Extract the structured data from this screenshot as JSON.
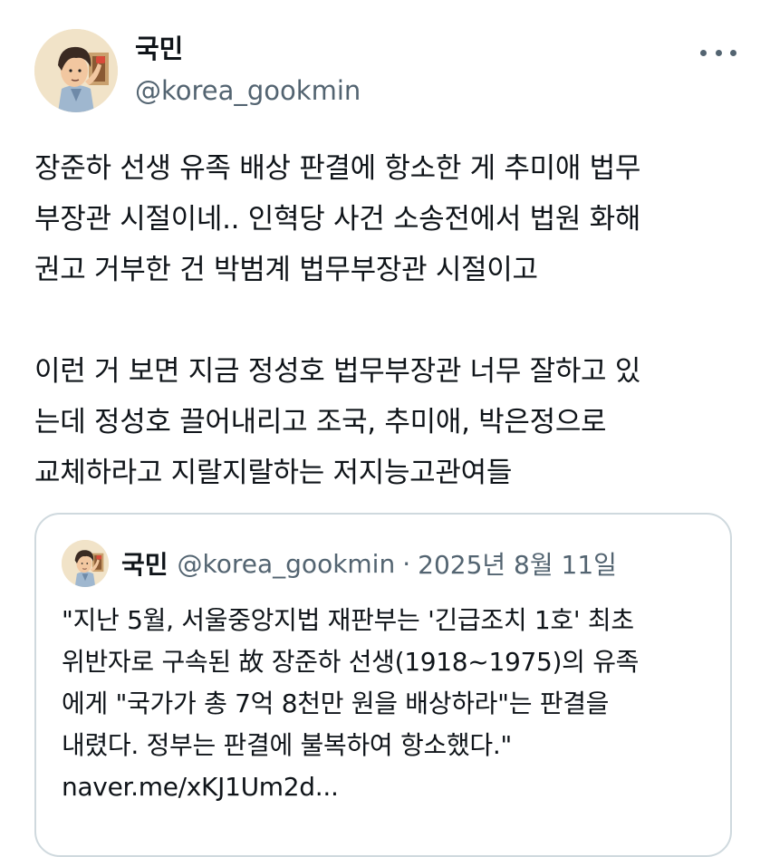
{
  "tweet": {
    "author": {
      "display_name": "국민",
      "handle": "@korea_gookmin",
      "avatar_icon": "cartoon-avatar"
    },
    "more_icon": "more-horizontal-icon",
    "text_lines": [
      "장준하 선생 유족 배상 판결에 항소한 게 추미애 법무",
      "부장관 시절이네.. 인혁당 사건 소송전에서 법원 화해",
      "권고 거부한 건 박범계 법무부장관 시절이고",
      "",
      "이런 거 보면 지금 정성호 법무부장관 너무 잘하고 있",
      "는데 정성호 끌어내리고 조국, 추미애, 박은정으로",
      "교체하라고 지랄지랄하는 저지능고관여들"
    ]
  },
  "quoted_tweet": {
    "author": {
      "display_name": "국민",
      "handle": "@korea_gookmin",
      "avatar_icon": "cartoon-avatar"
    },
    "separator": "·",
    "date": "2025년 8월 11일",
    "text_lines": [
      "\"지난 5월, 서울중앙지법 재판부는 '긴급조치 1호' 최초",
      "위반자로 구속된 故 장준하 선생(1918~1975)의 유족",
      "에게 \"국가가 총 7억 8천만 원을 배상하라\"는 판결을",
      "내렸다. 정부는 판결에 불복하여 항소했다.\"",
      "naver.me/xKJ1Um2d..."
    ]
  },
  "colors": {
    "text_primary": "#0f1419",
    "text_secondary": "#536471",
    "border": "#cfd9de",
    "background": "#ffffff"
  }
}
